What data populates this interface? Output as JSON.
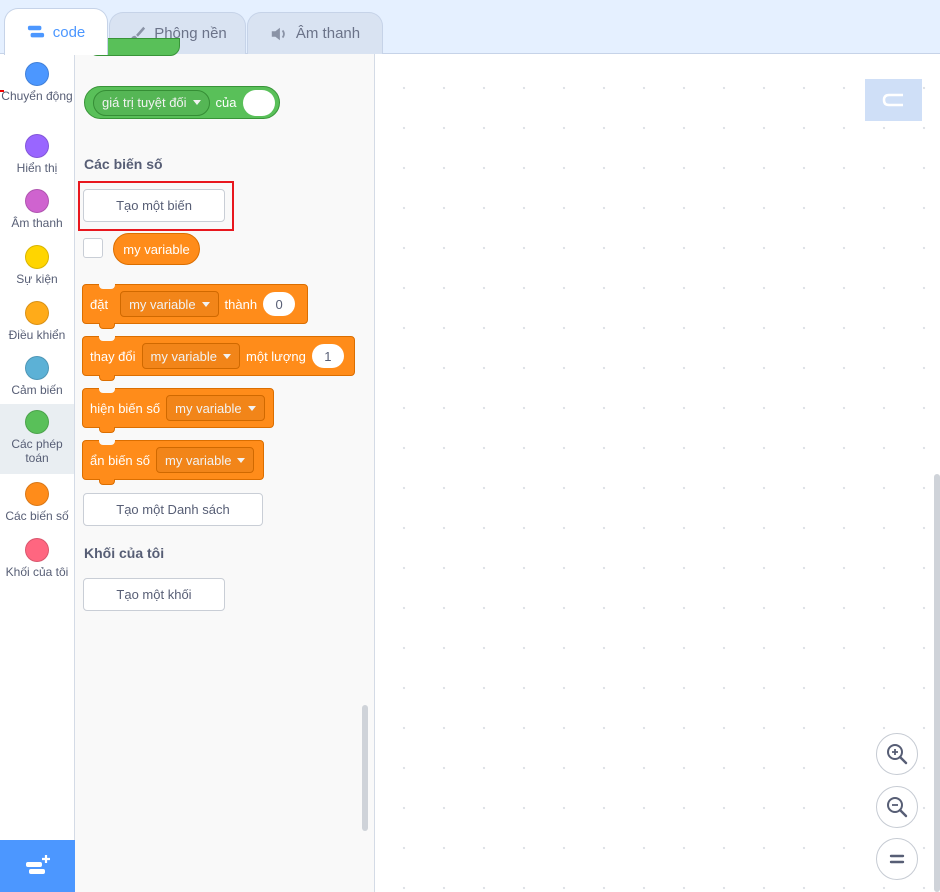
{
  "tabs": [
    {
      "label": "code",
      "icon": "code-icon",
      "active": true
    },
    {
      "label": "Phông nền",
      "icon": "paintbrush-icon",
      "active": false
    },
    {
      "label": "Âm thanh",
      "icon": "speaker-icon",
      "active": false
    }
  ],
  "categories": [
    {
      "label": "Chuyển động",
      "color": "#4c97ff"
    },
    {
      "label": "Hiển thị",
      "color": "#9966ff"
    },
    {
      "label": "Âm thanh",
      "color": "#cf63cf"
    },
    {
      "label": "Sự kiện",
      "color": "#ffd500"
    },
    {
      "label": "Điều khiển",
      "color": "#ffab19"
    },
    {
      "label": "Cảm biến",
      "color": "#5cb1d6"
    },
    {
      "label": "Các phép toán",
      "color": "#59c059",
      "selected": true
    },
    {
      "label": "Các biến số",
      "color": "#ff8c1a"
    },
    {
      "label": "Khối của tôi",
      "color": "#ff6680"
    }
  ],
  "palette": {
    "abs_block": {
      "op": "giá trị tuyệt đối",
      "of": "của"
    },
    "variables_heading": "Các biến số",
    "make_variable": "Tạo một biến",
    "variable_reporter": "my variable",
    "set_block": {
      "label": "đặt",
      "var": "my variable",
      "to": "thành",
      "value": "0"
    },
    "change_block": {
      "label": "thay đổi",
      "var": "my variable",
      "by": "một lượng",
      "value": "1"
    },
    "show_block": {
      "label": "hiện biến số",
      "var": "my variable"
    },
    "hide_block": {
      "label": "ẩn biến số",
      "var": "my variable"
    },
    "make_list": "Tạo một Danh sách",
    "my_blocks_heading": "Khối của tôi",
    "make_block": "Tạo một khối"
  },
  "workspace": {
    "zoom_in_icon": "zoom-in-icon",
    "zoom_out_icon": "zoom-out-icon",
    "zoom_reset_icon": "equals-icon"
  },
  "colors": {
    "accent": "#4c97ff",
    "variables": "#ff8c1a",
    "operators": "#59c059",
    "highlight": "#e8171e"
  }
}
